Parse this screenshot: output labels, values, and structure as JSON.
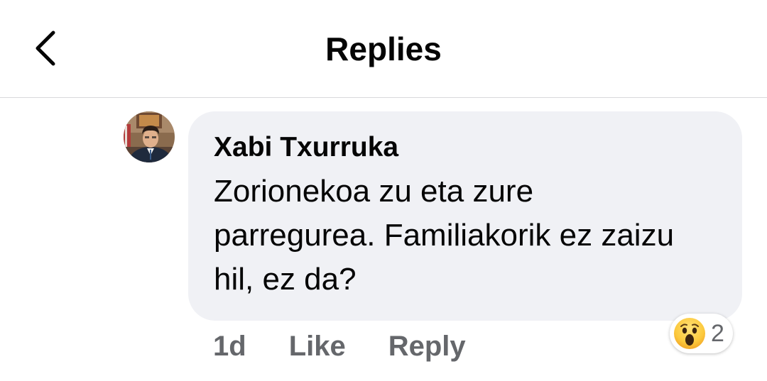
{
  "header": {
    "title": "Replies",
    "back_icon": "chevron-left-icon"
  },
  "comment": {
    "author": "Xabi Txurruka",
    "text": "Zorionekoa zu eta zure parregurea. Familiakorik ez zaizu hil, ez da?",
    "time": "1d",
    "like_label": "Like",
    "reply_label": "Reply",
    "reaction": {
      "icon": "wow-reaction-icon",
      "count": "2"
    }
  },
  "colors": {
    "bubble_bg": "#f0f1f5",
    "secondary_text": "#65676b",
    "primary_text": "#050505",
    "divider": "#d9d9dc"
  }
}
